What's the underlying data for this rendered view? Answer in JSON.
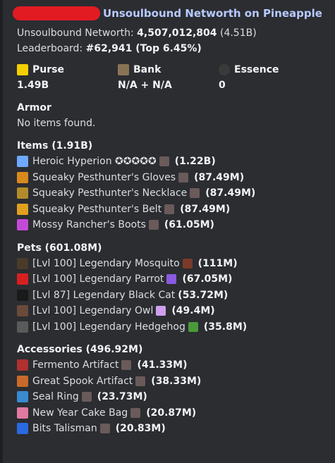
{
  "header": {
    "title": "Unsoulbound Networth on Pineapple"
  },
  "summary": {
    "networth_label": "Unsoulbound Networth: ",
    "networth_value": "4,507,012,804",
    "networth_short": " (4.51B)",
    "leaderboard_label": "Leaderboard: ",
    "leaderboard_value": "#62,941",
    "leaderboard_top": " (Top 6.45%)"
  },
  "fields": [
    {
      "label": "Purse",
      "value": "1.49B",
      "icon": "gold-ingot-icon",
      "color": "#f5d000"
    },
    {
      "label": "Bank",
      "value": "N/A + N/A",
      "icon": "bank-chest-icon",
      "color": "#8a7355"
    },
    {
      "label": "Essence",
      "value": "0",
      "icon": "essence-orb-icon",
      "color": "#3a3a3a"
    }
  ],
  "armor": {
    "title": "Armor",
    "empty_text": "No items found."
  },
  "items": {
    "title": "Items (1.91B)",
    "rows": [
      {
        "name": "Heroic Hyperion ✪✪✪✪✪",
        "value": "(1.22B)",
        "icon": "sword-icon",
        "color": "#6fa8ff"
      },
      {
        "name": "Squeaky Pesthunter's Gloves",
        "value": "(87.49M)",
        "icon": "gloves-icon",
        "color": "#d98a1f"
      },
      {
        "name": "Squeaky Pesthunter's Necklace",
        "value": "(87.49M)",
        "icon": "necklace-icon",
        "color": "#b38b2a"
      },
      {
        "name": "Squeaky Pesthunter's Belt",
        "value": "(87.49M)",
        "icon": "belt-icon",
        "color": "#e0a020"
      },
      {
        "name": "Mossy Rancher's Boots",
        "value": "(61.05M)",
        "icon": "boots-icon",
        "color": "#c34ad6"
      }
    ]
  },
  "pets": {
    "title": "Pets (601.08M)",
    "rows": [
      {
        "name": "[Lvl 100] Legendary Mosquito",
        "value": "(111M)",
        "icon": "mosquito-icon",
        "color": "#4a3a2a",
        "item_color": "#7a3a2a"
      },
      {
        "name": "[Lvl 100] Legendary Parrot",
        "value": "(67.05M)",
        "icon": "parrot-icon",
        "color": "#d62020",
        "item_color": "#8a5ae0"
      },
      {
        "name": "[Lvl 87] Legendary Black Cat",
        "value": "(53.72M)",
        "icon": "black-cat-icon",
        "color": "#1a1a1a",
        "item_color": ""
      },
      {
        "name": "[Lvl 100] Legendary Owl",
        "value": "(49.4M)",
        "icon": "owl-icon",
        "color": "#6a4a3a",
        "item_color": "#d0a0f0"
      },
      {
        "name": "[Lvl 100] Legendary Hedgehog",
        "value": "(35.8M)",
        "icon": "hedgehog-icon",
        "color": "#5a5a5a",
        "item_color": "#4a9a3a"
      }
    ]
  },
  "accessories": {
    "title": "Accessories (496.92M)",
    "rows": [
      {
        "name": "Fermento Artifact",
        "value": "(41.33M)",
        "icon": "fermento-icon",
        "color": "#b03030"
      },
      {
        "name": "Great Spook Artifact",
        "value": "(38.33M)",
        "icon": "spook-icon",
        "color": "#c86a2a"
      },
      {
        "name": "Seal Ring",
        "value": "(23.73M)",
        "icon": "seal-ring-icon",
        "color": "#3a8ad0"
      },
      {
        "name": "New Year Cake Bag",
        "value": "(20.87M)",
        "icon": "cake-bag-icon",
        "color": "#e07aa0"
      },
      {
        "name": "Bits Talisman",
        "value": "(20.83M)",
        "icon": "bits-icon",
        "color": "#2a6ae0"
      }
    ]
  },
  "enrich_icon": {
    "name": "enrichment-head-icon",
    "color": "#6a5a5a"
  }
}
